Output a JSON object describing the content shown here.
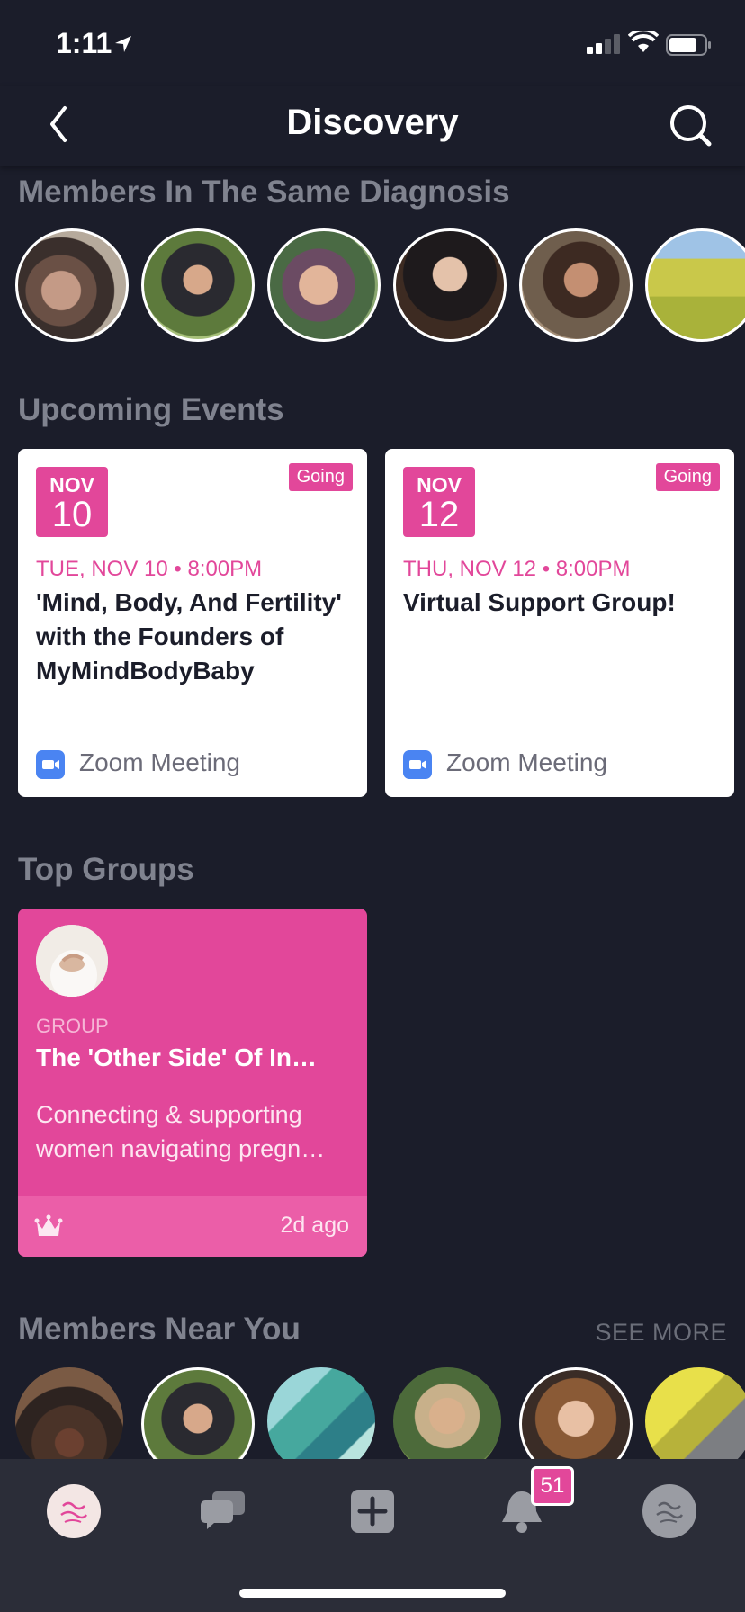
{
  "status_bar": {
    "time": "1:11"
  },
  "nav": {
    "title": "Discovery",
    "back_icon": "chevron-left-icon",
    "search_icon": "search-icon"
  },
  "sections": {
    "same_diagnosis": {
      "title": "Members In The Same Diagnosis"
    },
    "upcoming_events": {
      "title": "Upcoming Events"
    },
    "top_groups": {
      "title": "Top Groups"
    },
    "members_near": {
      "title": "Members Near You",
      "see_more": "SEE MORE"
    }
  },
  "events": [
    {
      "month": "NOV",
      "day": "10",
      "status": "Going",
      "datetime": "TUE, NOV 10 • 8:00PM",
      "title": "'Mind, Body, And Fertility' with the Founders of MyMindBodyBaby",
      "location": "Zoom Meeting"
    },
    {
      "month": "NOV",
      "day": "12",
      "status": "Going",
      "datetime": "THU, NOV 12 • 8:00PM",
      "title": "Virtual Support Group!",
      "location": "Zoom Meeting"
    }
  ],
  "group": {
    "type": "GROUP",
    "name": "The 'Other Side' Of In…",
    "description": "Connecting & supporting women navigating pregn…",
    "time": "2d ago"
  },
  "tab_bar": {
    "notification_count": "51"
  },
  "colors": {
    "accent": "#e2479a",
    "background": "#1b1d2a",
    "tab_bar": "#2b2d38"
  }
}
